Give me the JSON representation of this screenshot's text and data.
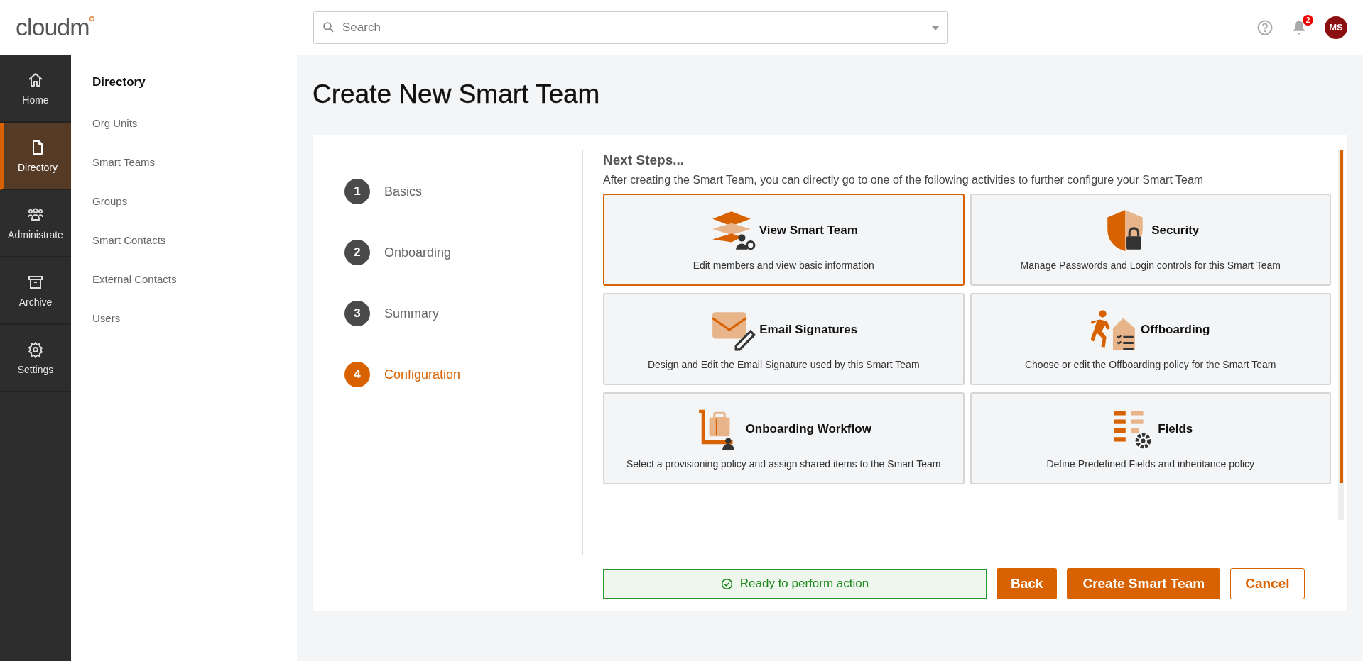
{
  "header": {
    "logo": "cloudm",
    "search": {
      "placeholder": "Search"
    },
    "notifications": "2",
    "avatar": "MS"
  },
  "rail": [
    {
      "label": "Home",
      "kind": "home",
      "selected": false
    },
    {
      "label": "Directory",
      "kind": "file",
      "selected": true
    },
    {
      "label": "Administrate",
      "kind": "people",
      "selected": false
    },
    {
      "label": "Archive",
      "kind": "archive",
      "selected": false
    },
    {
      "label": "Settings",
      "kind": "gear",
      "selected": false
    }
  ],
  "sidebar": {
    "title": "Directory",
    "items": [
      "Org Units",
      "Smart Teams",
      "Groups",
      "Smart Contacts",
      "External Contacts",
      "Users"
    ]
  },
  "page_title": "Create New Smart Team",
  "steps": [
    {
      "number": "1",
      "label": "Basics",
      "selected": false
    },
    {
      "number": "2",
      "label": "Onboarding",
      "selected": false
    },
    {
      "number": "3",
      "label": "Summary",
      "selected": false
    },
    {
      "number": "4",
      "label": "Configuration",
      "selected": true
    }
  ],
  "next_steps": {
    "title": "Next Steps...",
    "description": "After creating the Smart Team, you can directly go to one of the following activities to further configure your Smart Team",
    "cards": [
      {
        "kind": "team",
        "title": "View Smart Team",
        "description": "Edit members and view basic information",
        "selected": true
      },
      {
        "kind": "security",
        "title": "Security",
        "description": "Manage Passwords and Login controls for this Smart Team",
        "selected": false
      },
      {
        "kind": "email",
        "title": "Email Signatures",
        "description": "Design and Edit the Email Signature used by this Smart Team",
        "selected": false
      },
      {
        "kind": "offboarding",
        "title": "Offboarding",
        "description": "Choose or edit the Offboarding policy for the Smart Team",
        "selected": false
      },
      {
        "kind": "workflow",
        "title": "Onboarding Workflow",
        "description": "Select a provisioning policy and assign shared items to the Smart Team",
        "selected": false
      },
      {
        "kind": "fields",
        "title": "Fields",
        "description": "Define Predefined Fields and inheritance policy",
        "selected": false
      }
    ]
  },
  "status": {
    "kind": "ready",
    "text": "Ready to perform action"
  },
  "buttons": [
    {
      "kind": "primary",
      "label": "Back"
    },
    {
      "kind": "primary",
      "label": "Create Smart Team"
    },
    {
      "kind": "outline",
      "label": "Cancel"
    }
  ]
}
